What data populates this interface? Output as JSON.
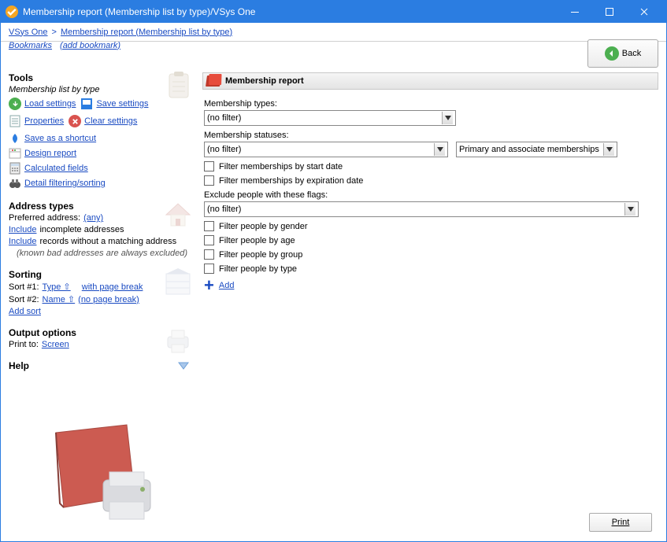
{
  "window": {
    "title": "Membership report (Membership list by type)/VSys One"
  },
  "breadcrumbs": {
    "app": "VSys One",
    "page": "Membership report (Membership list by type)"
  },
  "bookmarks": {
    "label": "Bookmarks",
    "add": "(add bookmark)"
  },
  "back_btn": "Back",
  "left": {
    "tools_head": "Tools",
    "tools_sub": "Membership list by type",
    "load": "Load settings",
    "save": "Save settings",
    "props": "Properties",
    "clear": "Clear settings",
    "saveas": "Save as a shortcut",
    "design": "Design report",
    "calc": "Calculated fields",
    "detail": "Detail filtering/sorting",
    "addr_head": "Address types",
    "pref_addr_lbl": "Preferred address:",
    "pref_addr_val": "(any)",
    "include1_lnk": "Include",
    "include1_txt": " incomplete addresses",
    "include2_lnk": "Include",
    "include2_txt": " records without a matching address",
    "addr_note": "(known bad addresses are always excluded)",
    "sort_head": "Sorting",
    "sort1_lbl": "Sort #1: ",
    "sort1_type": "Type ⇧",
    "sort1_pb": "with page break",
    "sort2_lbl": "Sort #2: ",
    "sort2_name": "Name  ⇧",
    "sort2_pb": "(no page break)",
    "add_sort": "Add sort",
    "output_head": "Output options",
    "printto_lbl": "Print to:  ",
    "printto_val": "Screen",
    "help_head": "Help"
  },
  "main": {
    "panel_title": "Membership report",
    "mtypes_lbl": "Membership types:",
    "mtypes_val": "(no filter)",
    "mstatus_lbl": "Membership statuses:",
    "mstatus_val": "(no filter)",
    "assoc_val": "Primary and associate memberships",
    "cb_start": "Filter memberships by start date",
    "cb_exp": "Filter memberships by expiration date",
    "excl_lbl": "Exclude people with these flags:",
    "excl_val": "(no filter)",
    "cb_gender": "Filter people by gender",
    "cb_age": "Filter people by age",
    "cb_group": "Filter people by group",
    "cb_type": "Filter people by type",
    "add": "Add"
  },
  "print_btn": "Print"
}
